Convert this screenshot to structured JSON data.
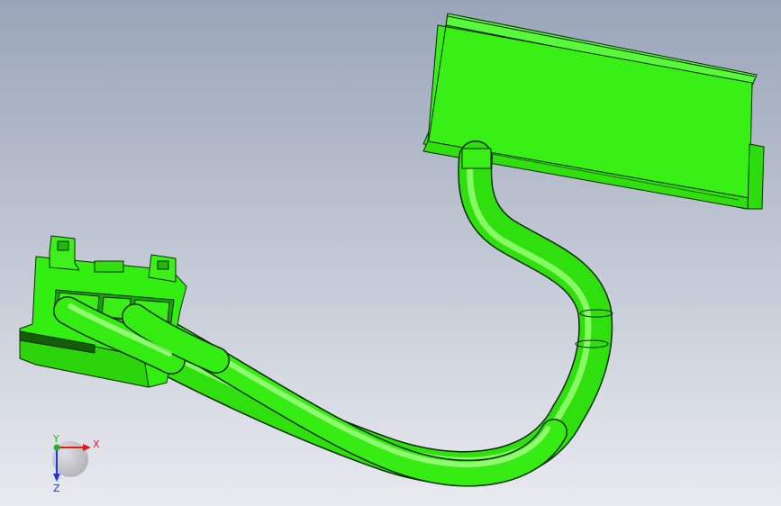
{
  "viewport": {
    "background_top": "#9aa5b9",
    "background_bottom": "#e8eaef",
    "model_color": "#33ee11",
    "model_highlight": "#9cff7a",
    "model_shadow": "#22b80a",
    "edge_color": "#0b2a05"
  },
  "triad": {
    "x_label": "X",
    "y_label": "Y",
    "z_label": "Z",
    "x_color": "#e21b1b",
    "y_color": "#27b327",
    "z_color": "#2036d6"
  }
}
